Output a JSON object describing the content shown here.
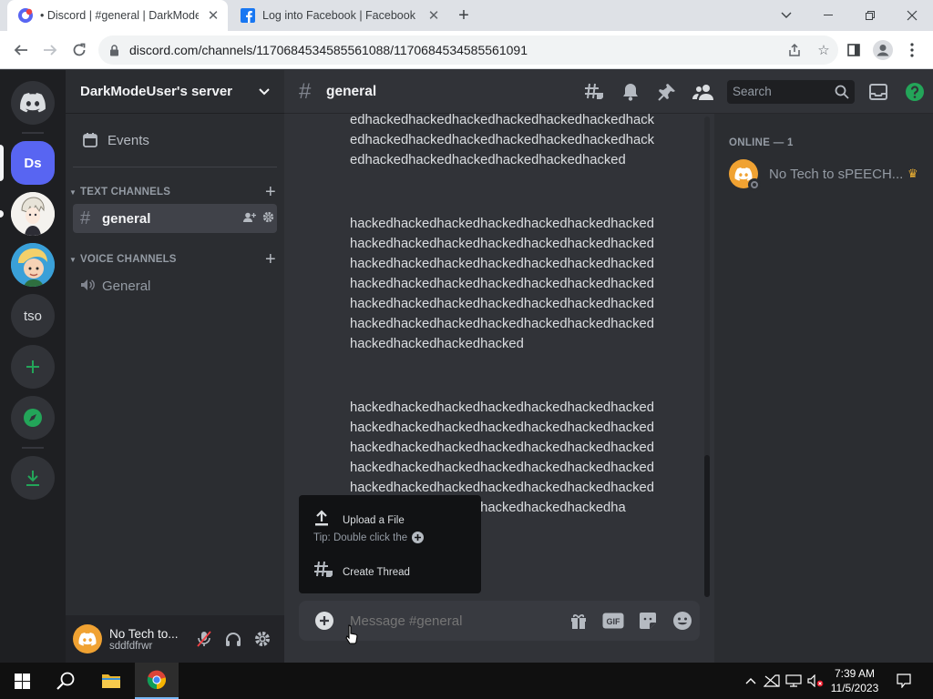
{
  "browser": {
    "tabs": [
      {
        "title": "• Discord | #general | DarkModeUser's server",
        "active": true
      },
      {
        "title": "Log into Facebook | Facebook",
        "active": false
      }
    ],
    "url": "discord.com/channels/1170684534585561088/1170684534585561091",
    "window_controls": [
      "chevron-down",
      "minimize",
      "restore",
      "close"
    ]
  },
  "guilds": [
    {
      "type": "home",
      "icon": "discord-logo-icon"
    },
    {
      "type": "server",
      "label": "Ds",
      "selected": true,
      "color": "#5865f2"
    },
    {
      "type": "server",
      "icon": "anime-avatar"
    },
    {
      "type": "server",
      "icon": "cartoon-avatar"
    },
    {
      "type": "server",
      "label": "tso"
    },
    {
      "type": "action",
      "icon": "add-server-icon",
      "color": "#23a559"
    },
    {
      "type": "action",
      "icon": "explore-icon",
      "color": "#23a559"
    },
    {
      "type": "action",
      "icon": "download-icon",
      "color": "#23a559"
    }
  ],
  "sidebar": {
    "server_name": "DarkModeUser's server",
    "events_label": "Events",
    "text_category": "TEXT CHANNELS",
    "voice_category": "VOICE CHANNELS",
    "text_channels": [
      {
        "name": "general",
        "active": true
      }
    ],
    "voice_channels": [
      {
        "name": "General"
      }
    ]
  },
  "user_panel": {
    "name": "No Tech to...",
    "tag": "sddfdfrwr"
  },
  "chat": {
    "channel": "general",
    "search_placeholder": "Search",
    "messages": [
      "edhackedhackedhackedhackedhackedhackedhackedhackedhackedhackedhackedhackedhackedhackedhackedhackedhackedhackedhackedhacked",
      "hackedhackedhackedhackedhackedhackedhackedhackedhackedhackedhackedhackedhackedhackedhackedhackedhackedhackedhackedhackedhackedhackedhackedhackedhackedhackedhackedhackedhackedhackedhackedhackedhackedhackedhackedhackedhackedhackedhackedhackedhackedhackedhackedhackedhackedhacked",
      "hackedhackedhackedhackedhackedhackedhackedhackedhackedhackedhackedhackedhackedhackedhackedhackedhackedhackedhackedhackedhackedhackedhackedhackedhackedhackedhackedhackedhackedhackedhackedhackedhackedhackedhackedhackedhackedhackedhackedhackedhackedha"
    ],
    "composer_placeholder": "Message #general"
  },
  "upload_popup": {
    "upload_label": "Upload a File",
    "tip_label": "Tip: Double click the",
    "thread_label": "Create Thread"
  },
  "members": {
    "heading": "ONLINE — 1",
    "list": [
      {
        "name": "No Tech to sPEECH...",
        "owner": true
      }
    ]
  },
  "taskbar": {
    "time": "7:39 AM",
    "date": "11/5/2023"
  },
  "colors": {
    "blurple": "#5865f2",
    "green": "#23a559",
    "avatar_orange": "#f0a232"
  }
}
